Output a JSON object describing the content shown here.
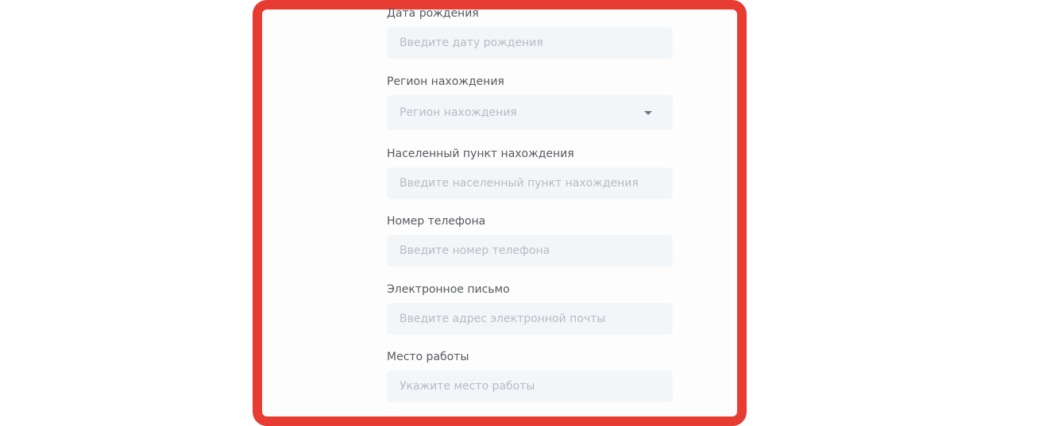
{
  "form": {
    "fields": [
      {
        "label": "Дата рождения",
        "placeholder": "Введите дату рождения",
        "type": "text"
      },
      {
        "label": "Регион нахождения",
        "placeholder": "Регион нахождения",
        "type": "select"
      },
      {
        "label": "Населенный пункт нахождения",
        "placeholder": "Введите населенный пункт нахождения",
        "type": "text"
      },
      {
        "label": "Номер телефона",
        "placeholder": "Введите номер телефона",
        "type": "text"
      },
      {
        "label": "Электронное письмо",
        "placeholder": "Введите адрес электронной почты",
        "type": "text"
      },
      {
        "label": "Место работы",
        "placeholder": "Укажите место работы",
        "type": "text"
      }
    ]
  },
  "icons": {
    "select_caret": "caret-down-icon"
  },
  "colors": {
    "highlight_border": "#e63c32",
    "input_background": "#f3f6f8",
    "label_text": "#555a60",
    "placeholder_text": "#b6bcc3"
  }
}
